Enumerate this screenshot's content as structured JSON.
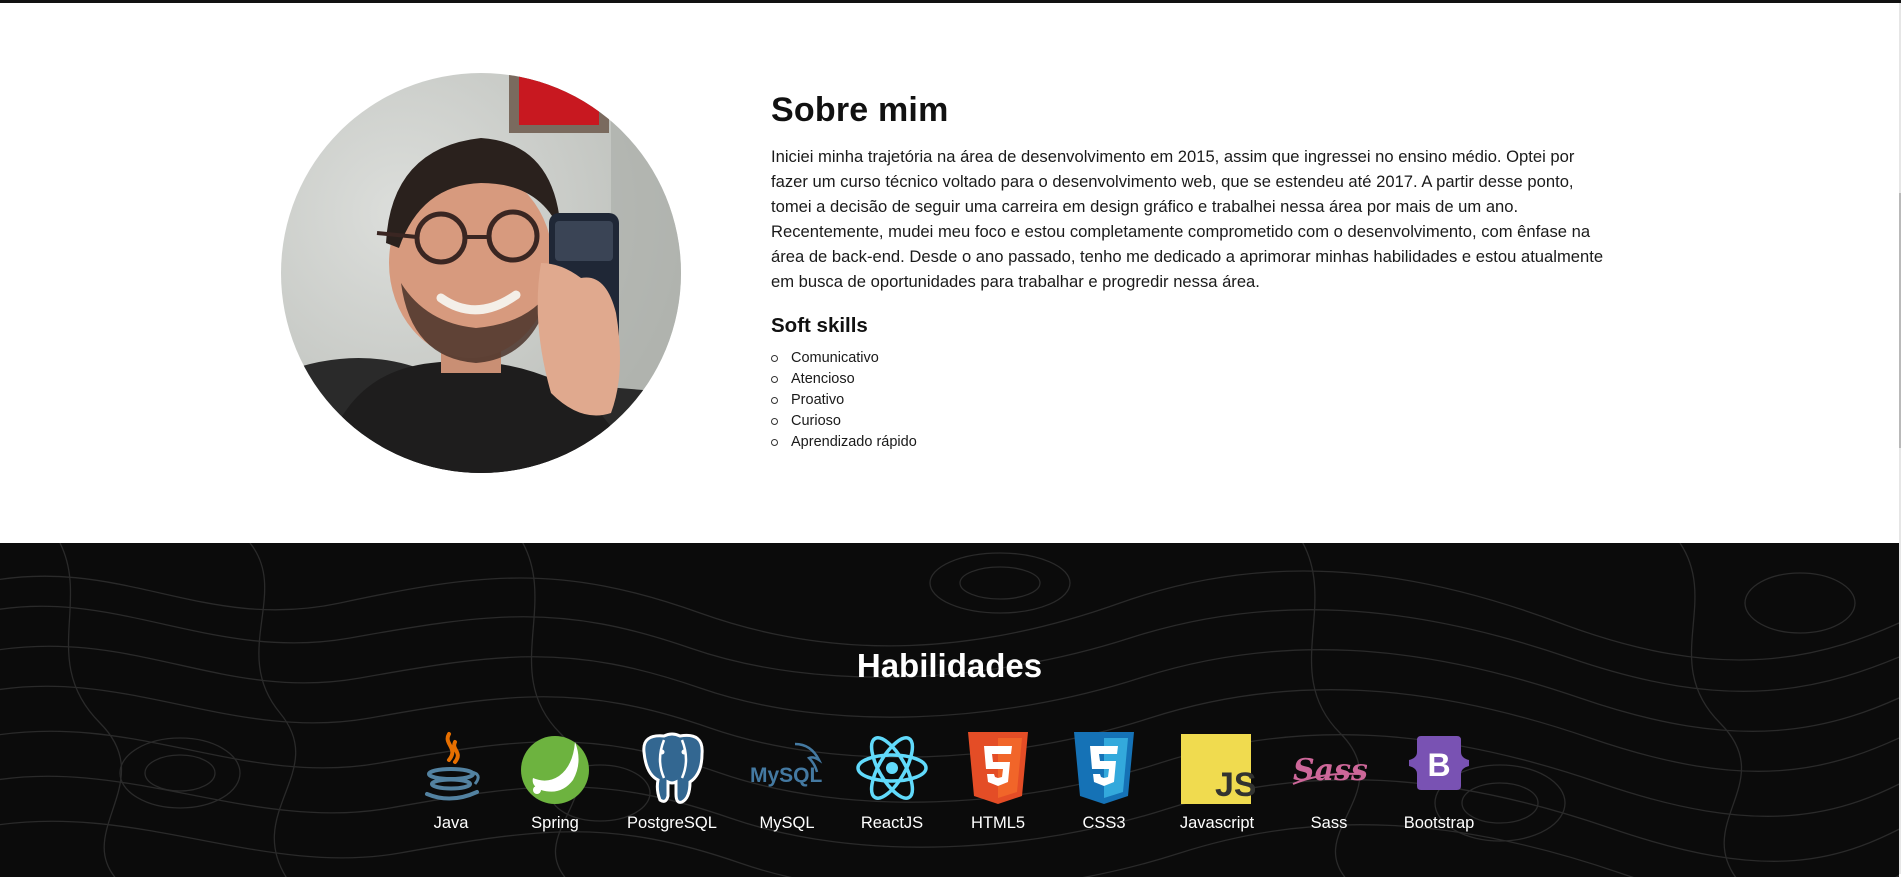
{
  "about": {
    "title": "Sobre mim",
    "paragraph": "Iniciei minha trajetória na área de desenvolvimento em 2015, assim que ingressei no ensino médio. Optei por fazer um curso técnico voltado para o desenvolvimento web, que se estendeu até 2017. A partir desse ponto, tomei a decisão de seguir uma carreira em design gráfico e trabalhei nessa área por mais de um ano. Recentemente, mudei meu foco e estou completamente comprometido com o desenvolvimento, com ênfase na área de back-end. Desde o ano passado, tenho me dedicado a aprimorar minhas habilidades e estou atualmente em busca de oportunidades para trabalhar e progredir nessa área.",
    "soft_skills_title": "Soft skills",
    "soft_skills": [
      "Comunicativo",
      "Atencioso",
      "Proativo",
      "Curioso",
      "Aprendizado rápido"
    ]
  },
  "skills": {
    "title": "Habilidades",
    "items": [
      {
        "label": "Java",
        "icon": "java-icon"
      },
      {
        "label": "Spring",
        "icon": "spring-icon"
      },
      {
        "label": "PostgreSQL",
        "icon": "postgresql-icon"
      },
      {
        "label": "MySQL",
        "icon": "mysql-icon"
      },
      {
        "label": "ReactJS",
        "icon": "react-icon"
      },
      {
        "label": "HTML5",
        "icon": "html5-icon"
      },
      {
        "label": "CSS3",
        "icon": "css3-icon"
      },
      {
        "label": "Javascript",
        "icon": "javascript-icon"
      },
      {
        "label": "Sass",
        "icon": "sass-icon"
      },
      {
        "label": "Bootstrap",
        "icon": "bootstrap-icon"
      }
    ],
    "icon_text": {
      "mysql": "MySQL",
      "javascript": "JS",
      "sass": "Sass",
      "bootstrap": "B"
    }
  },
  "colors": {
    "skills_background": "#0b0b0b",
    "java_blue": "#5382a1",
    "java_red": "#e76f00",
    "spring_green": "#6db33f",
    "postgres_blue": "#336791",
    "mysql_blue": "#4479a1",
    "mysql_orange": "#f29111",
    "react_cyan": "#61dafb",
    "html5_orange": "#e44d26",
    "css3_blue": "#1572b6",
    "js_yellow": "#f0db4f",
    "sass_pink": "#cd6799",
    "bootstrap_purple": "#7952b3"
  }
}
